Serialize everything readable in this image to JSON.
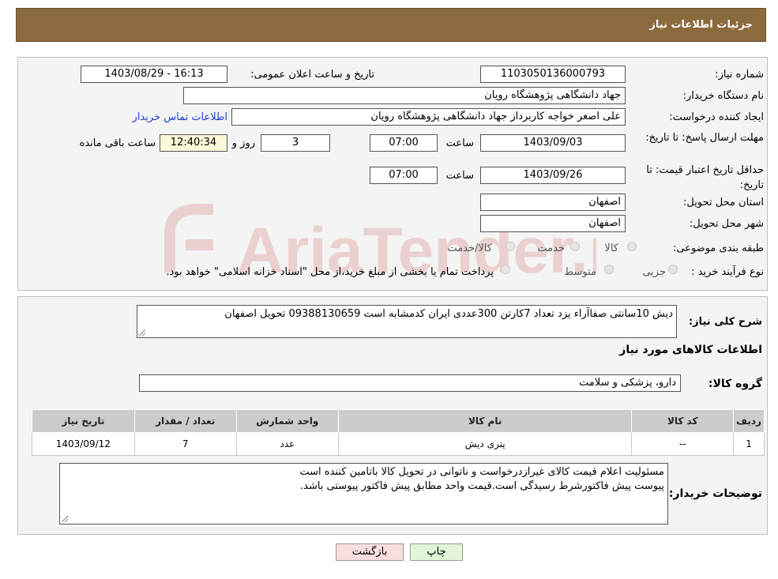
{
  "header": {
    "title": "جزئیات اطلاعات نیاز"
  },
  "watermark": {
    "text": "AriaTender.neT",
    "color": "#c0392b"
  },
  "form": {
    "need_number": {
      "label": "شماره نیاز:",
      "value": "1103050136000793"
    },
    "announce": {
      "label": "تاریخ و ساعت اعلان عمومی:",
      "value": "1403/08/29 - 16:13"
    },
    "buyer_org": {
      "label": "نام دستگاه خریدار:",
      "value": "جهاد دانشگاهی پژوهشگاه رویان"
    },
    "creator": {
      "label": "ایجاد کننده درخواست:",
      "value": "علی اصغر خواجه کاربرداز جهاد دانشگاهی پژوهشگاه رویان",
      "contact_link": "اطلاعات تماس خریدار"
    },
    "deadline": {
      "label": "مهلت ارسال پاسخ: تا تاریخ:",
      "date": "1403/09/03",
      "time_label": "ساعت",
      "time": "07:00",
      "days": "3",
      "days_label": "روز و",
      "remaining": "12:40:34",
      "remaining_label": "ساعت باقی مانده"
    },
    "validity": {
      "label": "حداقل تاریخ اعتبار قیمت: تا تاریخ:",
      "date": "1403/09/26",
      "time_label": "ساعت",
      "time": "07:00"
    },
    "province": {
      "label": "استان محل تحویل:",
      "value": "اصفهان"
    },
    "city": {
      "label": "شهر محل تحویل:",
      "value": "اصفهان"
    },
    "category": {
      "label": "طبقه بندی موضوعی:",
      "options": [
        "کالا",
        "خدمت",
        "کالا/خدمت"
      ]
    },
    "process": {
      "label": "نوع فرآیند خرید :",
      "options": [
        "جزیی",
        "متوسط"
      ],
      "note": "پرداخت تمام یا بخشی از مبلغ خرید،از محل \"اسناد خزانه اسلامی\" خواهد بود."
    }
  },
  "details": {
    "description_label": "شرح کلی نیاز:",
    "description": "دیش 10سانتی صفاآراء یزد  تعداد 7کارتن 300عددی   ایران کدمشابه است     09388130659  تحویل اصفهان",
    "items_title": "اطلاعات کالاهای مورد نیاز",
    "group_label": "گروه کالا:",
    "group_value": "دارو، پزشکی و سلامت",
    "table": {
      "headers": [
        "ردیف",
        "کد کالا",
        "نام کالا",
        "واحد شمارش",
        "تعداد / مقدار",
        "تاریخ نیاز"
      ],
      "rows": [
        [
          "1",
          "--",
          "پتری دیش",
          "عدد",
          "7",
          "1403/09/12"
        ]
      ]
    },
    "buyer_notes_label": "توضیحات خریدار:",
    "buyer_notes": [
      "مسئولیت اعلام قیمت کالای غیرازدرخواست و ناتوانی در تحویل کالا باتامین کننده است",
      "پیوست پیش فاکتورشرط رسیدگی است.قیمت واحد مطابق پیش فاکتور پیوستی باشد."
    ]
  },
  "buttons": {
    "print": "چاپ",
    "back": "بازگشت"
  }
}
